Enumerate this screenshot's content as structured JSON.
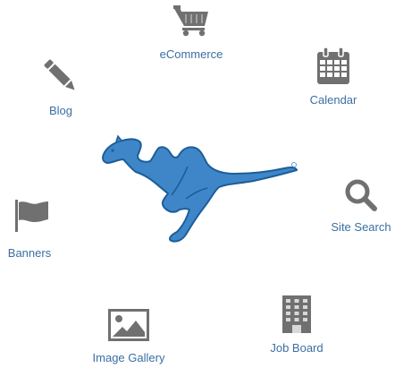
{
  "colors": {
    "icon": "#707070",
    "label": "#3a6fa3",
    "mascot": "#3f86c8",
    "mascot_outline": "#1c5e99"
  },
  "features": {
    "ecommerce": {
      "label": "eCommerce",
      "icon": "shopping-cart-icon"
    },
    "calendar": {
      "label": "Calendar",
      "icon": "calendar-icon"
    },
    "blog": {
      "label": "Blog",
      "icon": "pencil-icon"
    },
    "site_search": {
      "label": "Site Search",
      "icon": "search-icon"
    },
    "banners": {
      "label": "Banners",
      "icon": "flag-icon"
    },
    "job_board": {
      "label": "Job Board",
      "icon": "building-icon"
    },
    "image_gallery": {
      "label": "Image Gallery",
      "icon": "image-icon"
    }
  },
  "mascot": {
    "icon": "running-camel-logo"
  }
}
